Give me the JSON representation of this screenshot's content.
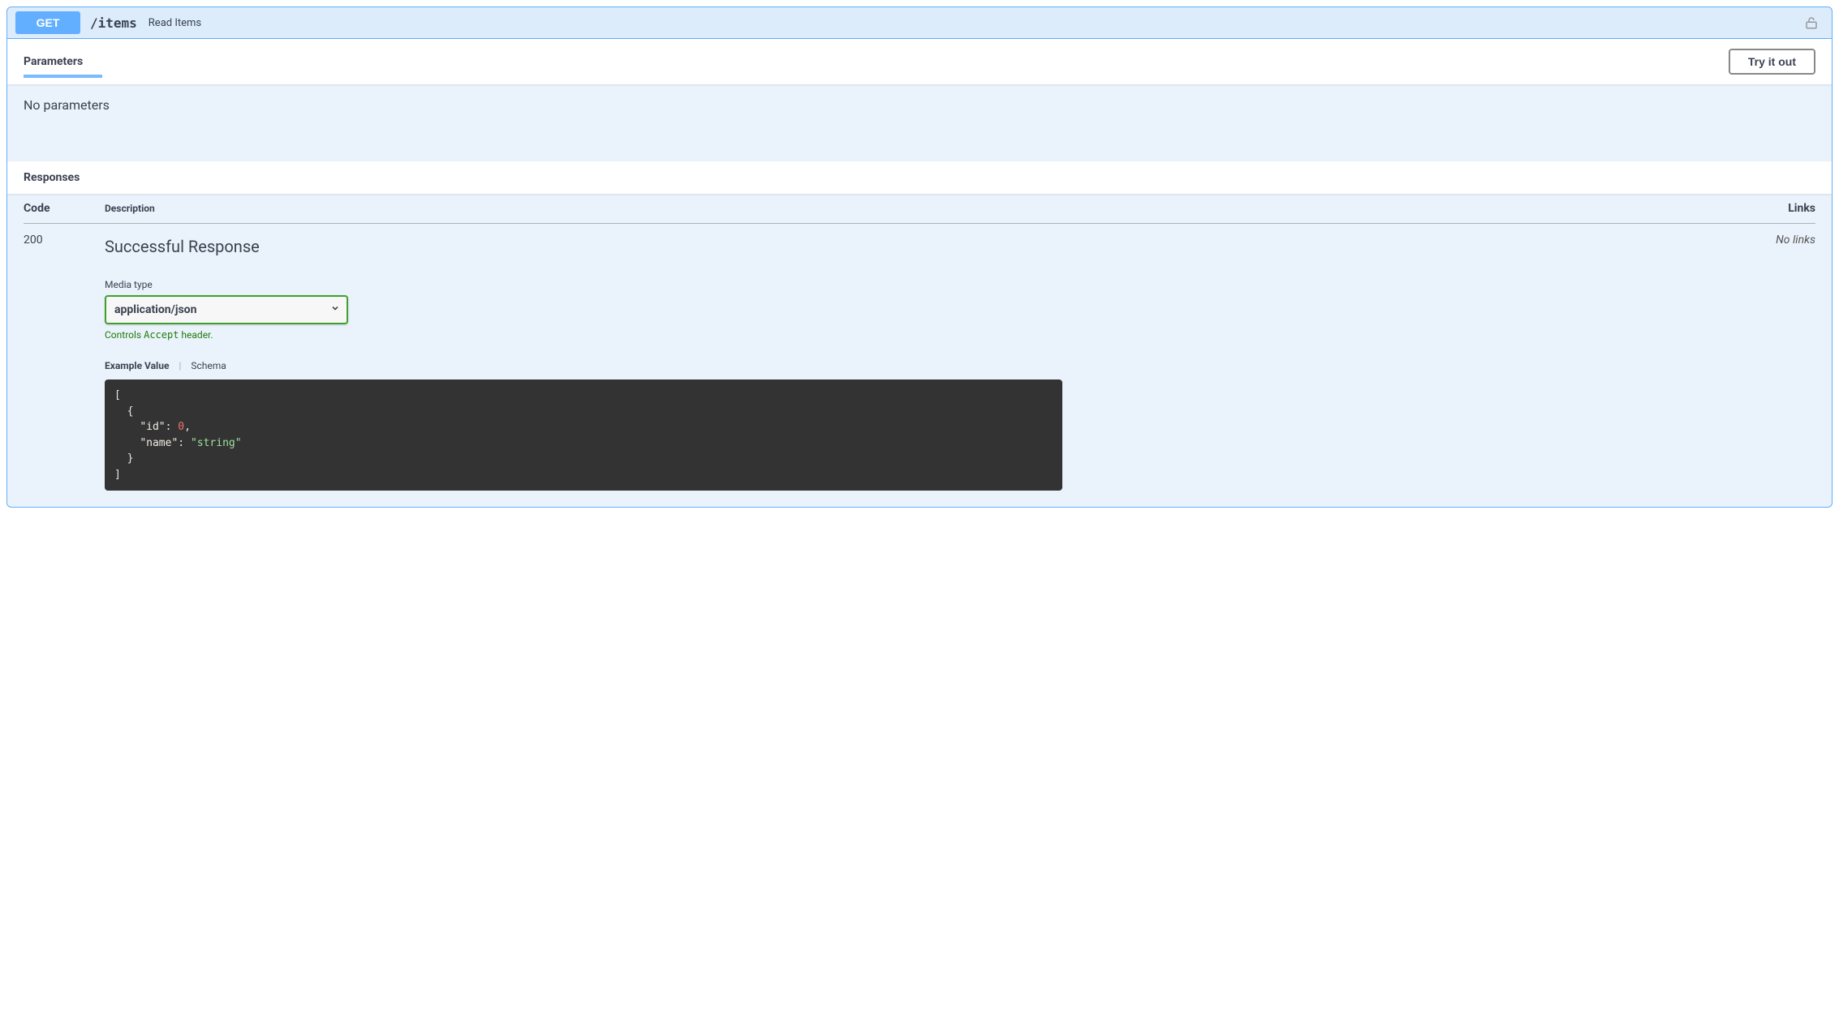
{
  "endpoint": {
    "method": "GET",
    "path": "/items",
    "summary": "Read Items"
  },
  "parameters": {
    "heading": "Parameters",
    "try_label": "Try it out",
    "empty_text": "No parameters"
  },
  "responses": {
    "heading": "Responses",
    "columns": {
      "code": "Code",
      "description": "Description",
      "links": "Links"
    },
    "items": [
      {
        "code": "200",
        "description": "Successful Response",
        "links_text": "No links",
        "media_type_label": "Media type",
        "media_type": "application/json",
        "accept_note_prefix": "Controls ",
        "accept_note_mono": "Accept",
        "accept_note_suffix": " header.",
        "tabs": {
          "example": "Example Value",
          "schema": "Schema"
        },
        "example": {
          "l1": "[",
          "l2": "  {",
          "l3a": "    ",
          "l3_key_id": "\"id\"",
          "l3b": ": ",
          "l3_val": "0",
          "l3c": ",",
          "l4a": "    ",
          "l4_key_name": "\"name\"",
          "l4b": ": ",
          "l4_val": "\"string\"",
          "l5": "  }",
          "l6": "]"
        }
      }
    ]
  }
}
